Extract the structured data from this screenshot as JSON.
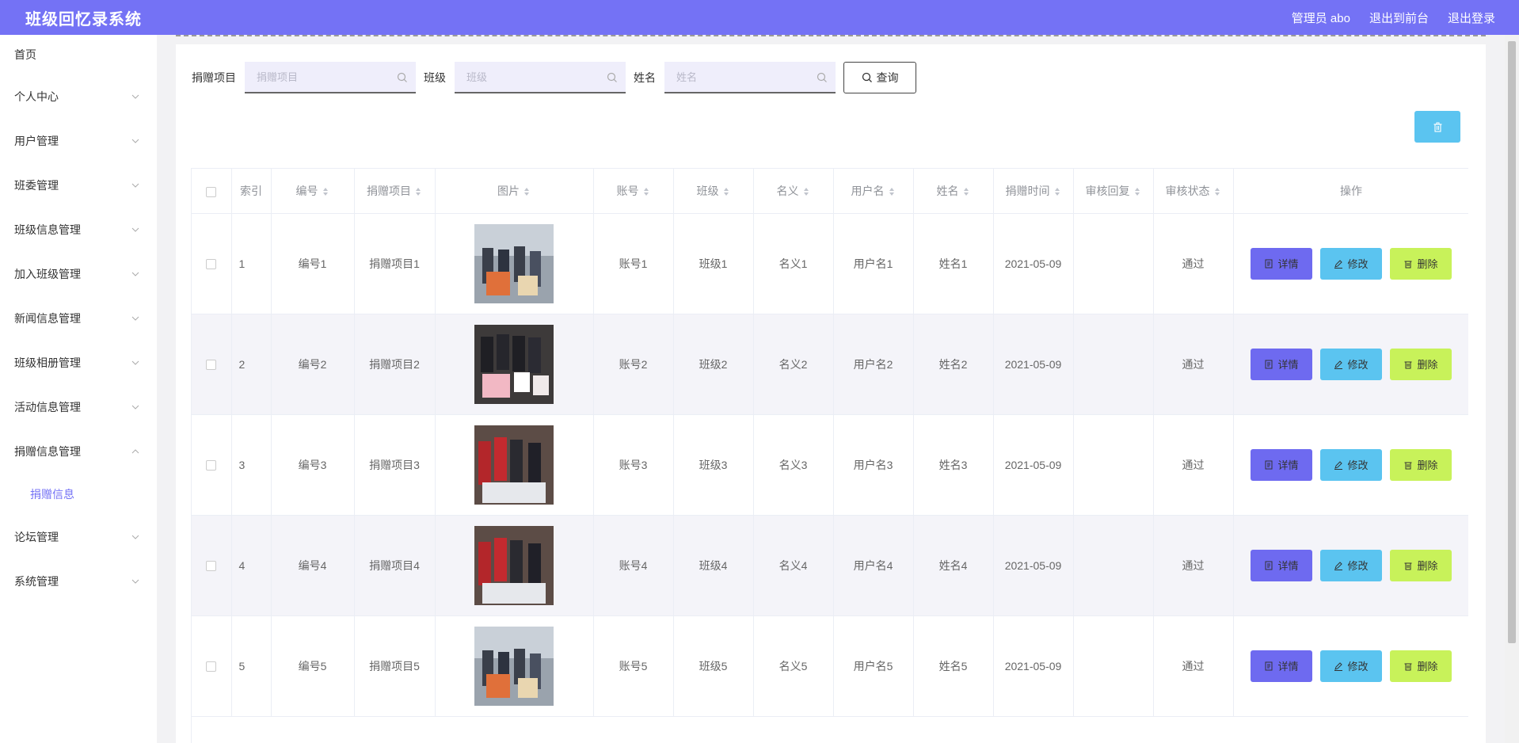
{
  "header": {
    "title": "班级回忆录系统",
    "admin": "管理员 abo",
    "to_front": "退出到前台",
    "logout": "退出登录"
  },
  "sidebar": {
    "items": [
      {
        "label": "首页"
      },
      {
        "label": "个人中心"
      },
      {
        "label": "用户管理"
      },
      {
        "label": "班委管理"
      },
      {
        "label": "班级信息管理"
      },
      {
        "label": "加入班级管理"
      },
      {
        "label": "新闻信息管理"
      },
      {
        "label": "班级相册管理"
      },
      {
        "label": "活动信息管理"
      },
      {
        "label": "捐赠信息管理"
      },
      {
        "label": "论坛管理"
      },
      {
        "label": "系统管理"
      }
    ],
    "sub_item": "捐赠信息"
  },
  "search": {
    "project_label": "捐赠项目",
    "project_placeholder": "捐赠项目",
    "class_label": "班级",
    "class_placeholder": "班级",
    "name_label": "姓名",
    "name_placeholder": "姓名",
    "query_label": "查询"
  },
  "table": {
    "headers": [
      "索引",
      "编号",
      "捐赠项目",
      "图片",
      "账号",
      "班级",
      "名义",
      "用户名",
      "姓名",
      "捐赠时间",
      "审核回复",
      "审核状态",
      "操作"
    ],
    "rows": [
      {
        "index": "1",
        "code": "编号1",
        "project": "捐赠项目1",
        "account": "账号1",
        "class": "班级1",
        "nominal": "名义1",
        "username": "用户名1",
        "name": "姓名1",
        "time": "2021-05-09",
        "reply": "",
        "status": "通过"
      },
      {
        "index": "2",
        "code": "编号2",
        "project": "捐赠项目2",
        "account": "账号2",
        "class": "班级2",
        "nominal": "名义2",
        "username": "用户名2",
        "name": "姓名2",
        "time": "2021-05-09",
        "reply": "",
        "status": "通过"
      },
      {
        "index": "3",
        "code": "编号3",
        "project": "捐赠项目3",
        "account": "账号3",
        "class": "班级3",
        "nominal": "名义3",
        "username": "用户名3",
        "name": "姓名3",
        "time": "2021-05-09",
        "reply": "",
        "status": "通过"
      },
      {
        "index": "4",
        "code": "编号4",
        "project": "捐赠项目4",
        "account": "账号4",
        "class": "班级4",
        "nominal": "名义4",
        "username": "用户名4",
        "name": "姓名4",
        "time": "2021-05-09",
        "reply": "",
        "status": "通过"
      },
      {
        "index": "5",
        "code": "编号5",
        "project": "捐赠项目5",
        "account": "账号5",
        "class": "班级5",
        "nominal": "名义5",
        "username": "用户名5",
        "name": "姓名5",
        "time": "2021-05-09",
        "reply": "",
        "status": "通过"
      }
    ],
    "ops": {
      "detail": "详情",
      "edit": "修改",
      "delete": "删除"
    }
  },
  "colors": {
    "primary": "#7472f5",
    "detail_btn": "#6e6af0",
    "edit_btn": "#5bc4f0",
    "delete_btn": "#c8f25a"
  }
}
